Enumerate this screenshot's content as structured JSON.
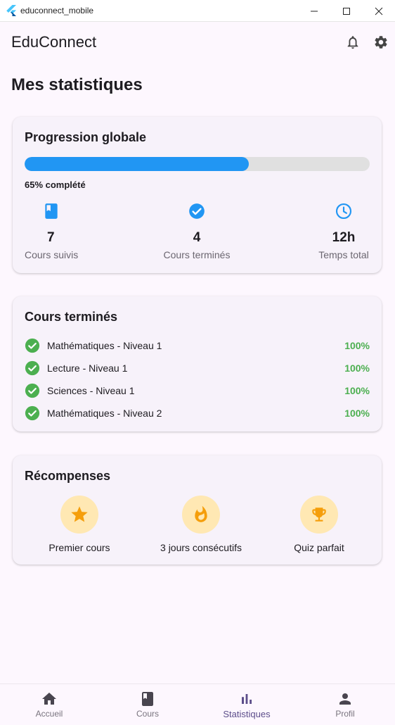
{
  "window": {
    "title": "educonnect_mobile"
  },
  "appbar": {
    "title": "EduConnect",
    "actions": [
      "bell-icon",
      "gear-icon"
    ]
  },
  "page": {
    "title": "Mes statistiques"
  },
  "progress_card": {
    "title": "Progression globale",
    "progress_fraction": 0.65,
    "progress_label": "65% complété",
    "stats": [
      {
        "icon": "book-icon",
        "value": "7",
        "label": "Cours suivis"
      },
      {
        "icon": "check-circle-icon",
        "value": "4",
        "label": "Cours terminés"
      },
      {
        "icon": "clock-icon",
        "value": "12h",
        "label": "Temps total"
      }
    ]
  },
  "completed_card": {
    "title": "Cours terminés",
    "courses": [
      {
        "name": "Mathématiques - Niveau 1",
        "percent": "100%"
      },
      {
        "name": "Lecture - Niveau 1",
        "percent": "100%"
      },
      {
        "name": "Sciences - Niveau 1",
        "percent": "100%"
      },
      {
        "name": "Mathématiques - Niveau 2",
        "percent": "100%"
      }
    ]
  },
  "rewards_card": {
    "title": "Récompenses",
    "rewards": [
      {
        "icon": "star-icon",
        "label": "Premier cours"
      },
      {
        "icon": "fire-icon",
        "label": "3 jours consécutifs"
      },
      {
        "icon": "trophy-icon",
        "label": "Quiz parfait"
      }
    ]
  },
  "bottom_nav": {
    "items": [
      {
        "icon": "home-icon",
        "label": "Accueil"
      },
      {
        "icon": "book-icon",
        "label": "Cours"
      },
      {
        "icon": "bar-chart-icon",
        "label": "Statistiques"
      },
      {
        "icon": "person-icon",
        "label": "Profil"
      }
    ],
    "active": "Statistiques"
  },
  "colors": {
    "accent_blue": "#2196f3",
    "success_green": "#4caf50",
    "reward_badge": "#ffe8b3",
    "reward_icon": "#f59e0b",
    "nav_active": "#5c4d8a"
  }
}
